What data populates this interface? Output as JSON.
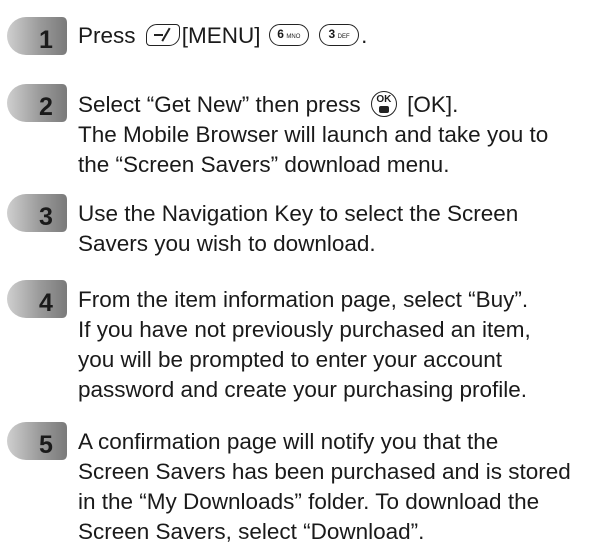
{
  "steps": [
    {
      "number": "1",
      "line1_a": "Press",
      "line1_b": "[MENU]",
      "key_6": {
        "digit": "6",
        "letters": "MNO"
      },
      "key_3": {
        "digit": "3",
        "letters": "DEF"
      },
      "line1_end": "."
    },
    {
      "number": "2",
      "line1_a": "Select “Get New” then press",
      "ok_key_label": "OK",
      "line1_b": "[OK].",
      "line2": "The Mobile Browser will launch and take you to",
      "line3": "the “Screen Savers” download menu."
    },
    {
      "number": "3",
      "line1": "Use the Navigation Key to select the Screen",
      "line2": "Savers you wish to download."
    },
    {
      "number": "4",
      "line1": "From the item information page, select “Buy”.",
      "line2": "If you have not previously purchased an item,",
      "line3": "you will be prompted to enter your account",
      "line4": "password and create your purchasing profile."
    },
    {
      "number": "5",
      "line1": "A confirmation page will notify you that the",
      "line2": "Screen Savers has been purchased and is stored",
      "line3": "in the “My Downloads” folder. To download the",
      "line4": "Screen Savers, select “Download”."
    }
  ]
}
